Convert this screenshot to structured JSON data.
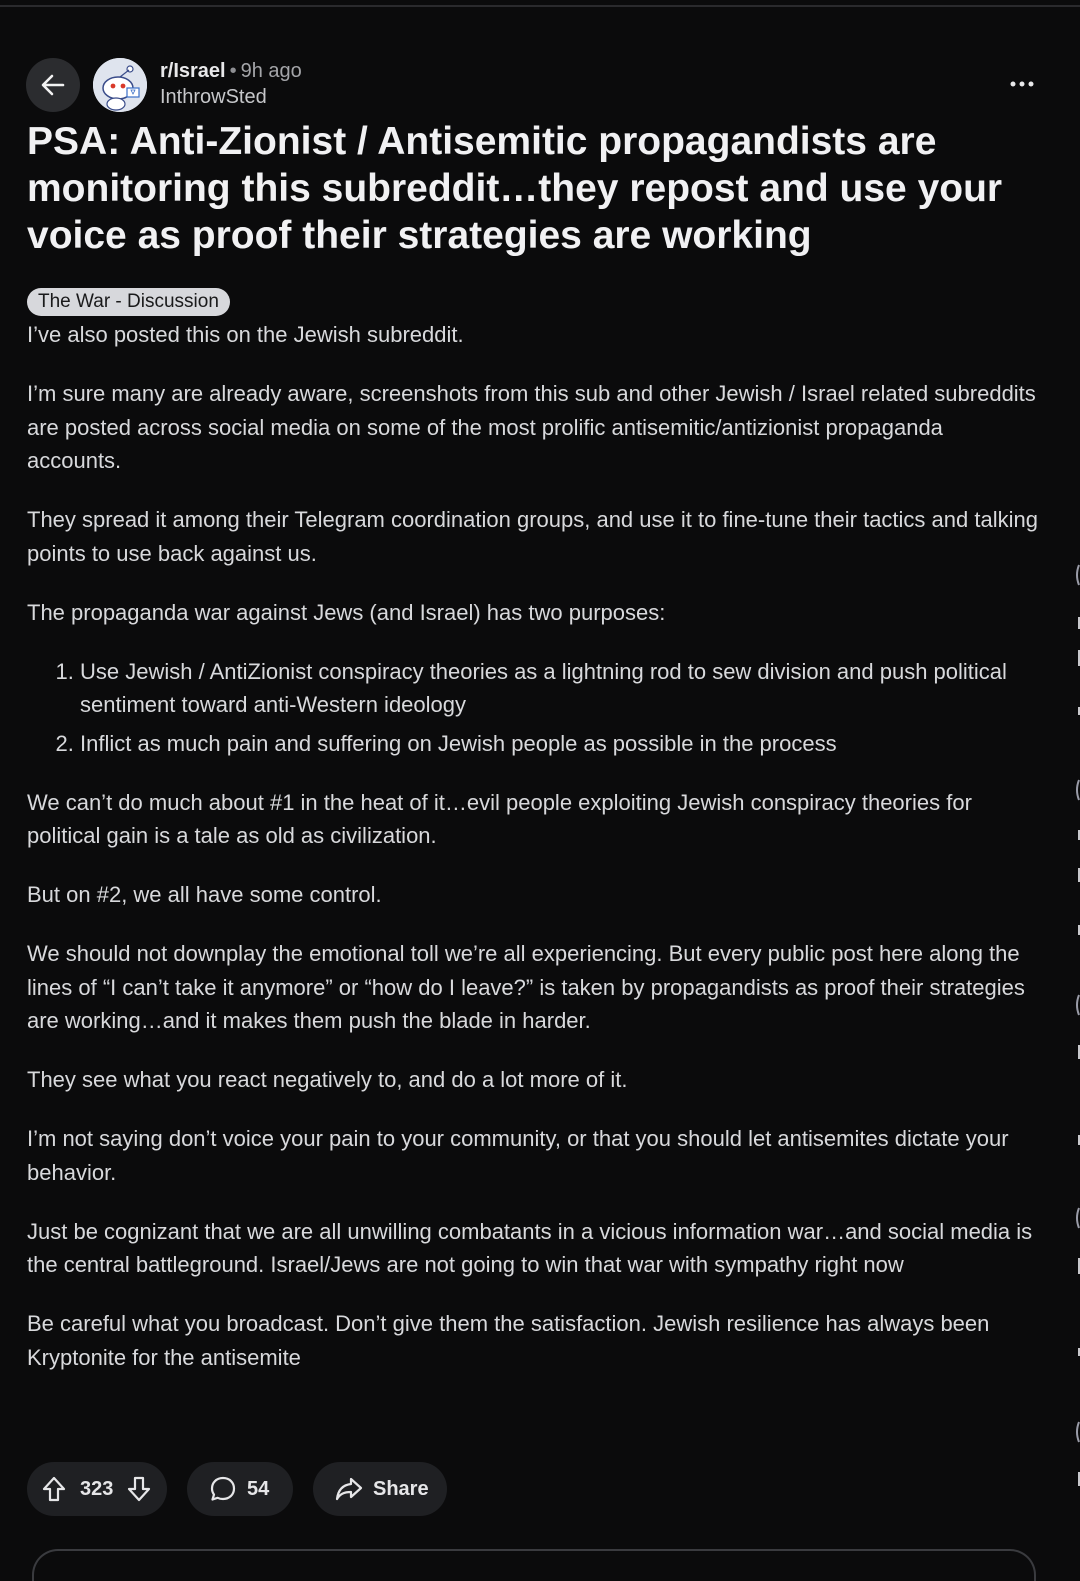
{
  "header": {
    "subreddit": "r/Israel",
    "separator": "•",
    "time_ago": "9h ago",
    "author": "InthrowSted"
  },
  "post": {
    "title": "PSA: Anti-Zionist / Antisemitic propagandists are monitoring this subreddit…they repost and use your voice as proof their strategies are working",
    "flair": "The War - Discussion",
    "paragraphs": {
      "p1": "I’ve also posted this on the Jewish subreddit.",
      "p2": "I’m sure many are already aware, screenshots from this sub and other Jewish / Israel related subreddits are posted across social media on some of the most prolific antisemitic/antizionist propaganda accounts.",
      "p3": "They spread it among their Telegram coordination groups, and use it to fine-tune their tactics and talking points to use back against us.",
      "p4": "The propaganda war against Jews (and Israel) has two purposes:",
      "list1": "Use Jewish / AntiZionist conspiracy theories as a lightning rod to sew division and push political sentiment toward anti-Western ideology",
      "list2": "Inflict as much pain and suffering on Jewish people as possible in the process",
      "p5": "We can’t do much about #1 in the heat of it…evil people exploiting Jewish conspiracy theories for political gain is a tale as old as civilization.",
      "p6": "But on #2, we all have some control.",
      "p7": "We should not downplay the emotional toll we’re all experiencing. But every public post here along the lines of “I can’t take it anymore” or “how do I leave?” is taken by propagandists as proof their strategies are working…and it makes them push the blade in harder.",
      "p8": "They see what you react negatively to, and do a lot more of it.",
      "p9": "I’m not saying don’t voice your pain to your community, or that you should let antisemites dictate your behavior.",
      "p10": "Just be cognizant that we are all unwilling combatants in a vicious information war…and social media is the central battleground. Israel/Jews are not going to win that war with sympathy right now",
      "p11": "Be careful what you broadcast. Don’t give them the satisfaction. Jewish resilience has always been Kryptonite for the antisemite"
    }
  },
  "actions": {
    "upvotes": "323",
    "comments": "54",
    "share_label": "Share"
  },
  "icons": {
    "back": "arrow-left-icon",
    "more": "more-horizontal-icon",
    "upvote": "upvote-arrow-icon",
    "downvote": "downvote-arrow-icon",
    "comment": "comment-bubble-icon",
    "share": "share-arrow-icon"
  },
  "colors": {
    "background": "#0b0b0c",
    "pill": "#1f2023",
    "flair_bg": "#d7d8dc",
    "text": "#d8d9dc"
  }
}
